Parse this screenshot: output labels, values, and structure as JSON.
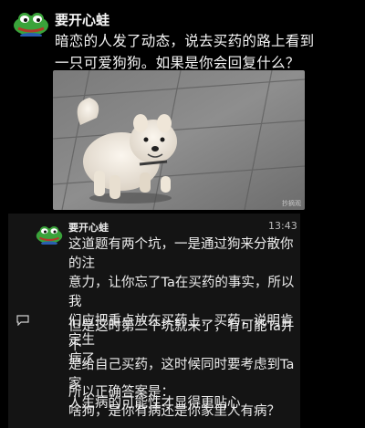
{
  "post": {
    "author": "要开心蛙",
    "text_line1": "暗恋的人发了动态，说去买药的路上看到",
    "text_line2": "一只可爱狗狗。如果是你会回复什么？",
    "photo_watermark": "抄摘观"
  },
  "reply": {
    "author": "要开心蛙",
    "time": "13:43",
    "p1_lines": [
      "这道题有两个坑，一是通过狗来分散你的注",
      "意力，让你忘了Ta在买药的事实，所以我",
      "们应把重点放在买药上，买药，说明肯定生",
      "病了"
    ],
    "p2_lines": [
      "但是这时第二个坑就来了，有可能Ta并不",
      "是给自己买药，这时候同时要考虑到Ta家",
      "人生病的可能性才显得更贴心"
    ],
    "p3_lines": [
      "所以正确答案是：",
      "啥狗，是你有病还是你家里人有病？"
    ]
  },
  "colors": {
    "background": "#000000",
    "card": "#141414",
    "frog": "#3aa33a"
  },
  "icons": [
    "pepe-frog-avatar",
    "comment-icon"
  ]
}
